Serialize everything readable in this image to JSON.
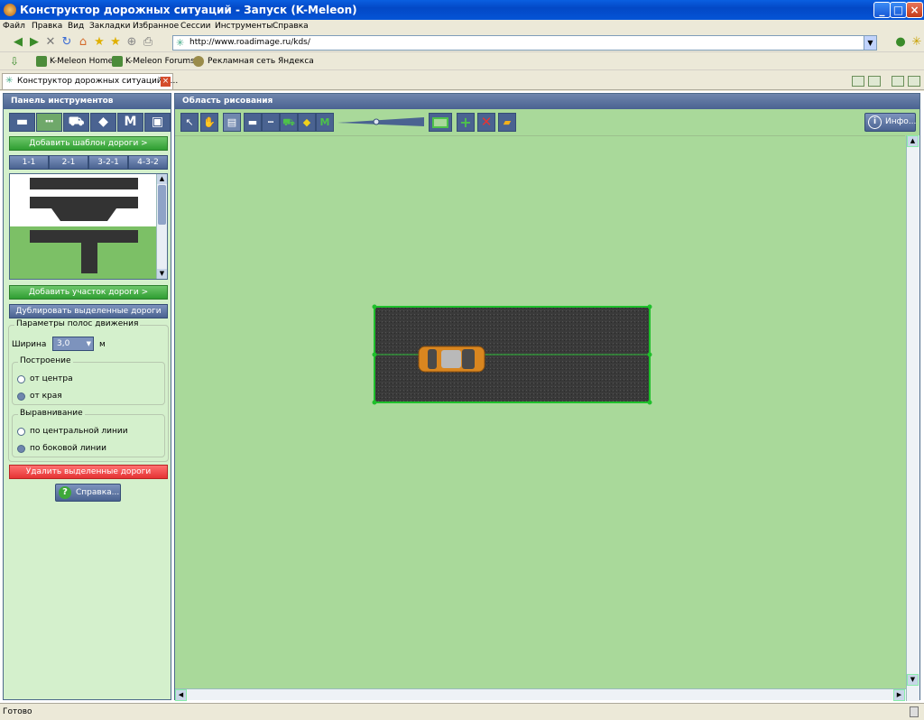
{
  "window": {
    "title": "Конструктор дорожных ситуаций - Запуск (K-Meleon)"
  },
  "menu": [
    "Файл",
    "Правка",
    "Вид",
    "Закладки",
    "Избранное",
    "Сессии",
    "Инструменты",
    "Справка"
  ],
  "address": {
    "url": "http://www.roadimage.ru/kds/"
  },
  "bookmarks": [
    "K-Meleon Home",
    "K-Meleon Forums",
    "Рекламная сеть Яндекса"
  ],
  "tab": {
    "label": "Конструктор дорожных ситуаций - ..."
  },
  "left_panel": {
    "title": "Панель инструментов",
    "add_template": "Добавить шаблон дороги >",
    "segments": [
      "1-1",
      "2-1",
      "3-2-1",
      "4-3-2"
    ],
    "add_section": "Добавить участок дороги >",
    "duplicate": "Дублировать выделенные дороги",
    "lanes_group": "Параметры полос движения",
    "width_label": "Ширина",
    "width_value": "3,0",
    "width_unit": "м",
    "build_group": "Построение",
    "build_options": [
      "от центра",
      "от края"
    ],
    "build_selected": 1,
    "align_group": "Выравнивание",
    "align_options": [
      "по центральной линии",
      "по боковой линии"
    ],
    "align_selected": 1,
    "delete": "Удалить выделенные дороги",
    "help": "Справка..."
  },
  "right_panel": {
    "title": "Область рисования",
    "info": "Инфо..."
  },
  "status": {
    "text": "Готово"
  },
  "colors": {
    "panel_header": "#4a6391",
    "canvas": "#a9d99a",
    "panel_bg": "#d4f0cc",
    "accent_green": "#2f9e32",
    "danger": "#e53434"
  }
}
